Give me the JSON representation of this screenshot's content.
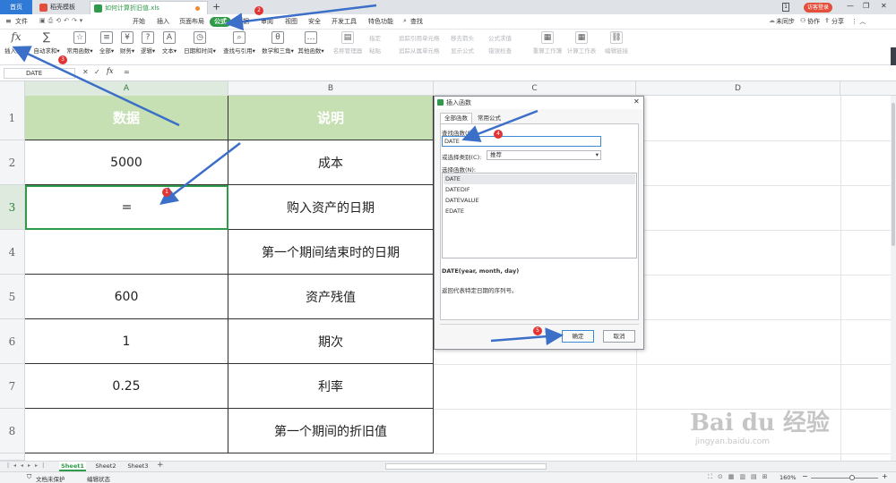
{
  "tabs": {
    "home": "首页",
    "template": "稻壳模板",
    "file": "如何计算折旧值.xls",
    "add": "+"
  },
  "titlebar": {
    "window_controls": [
      "1",
      "—",
      "❐",
      "✕"
    ],
    "login": "访客登录"
  },
  "menubar": {
    "file": "文件",
    "items": [
      "开始",
      "插入",
      "页面布局",
      "公式",
      "数据",
      "审阅",
      "视图",
      "安全",
      "开发工具",
      "特色功能"
    ],
    "active": "公式",
    "search": "查找",
    "sync": "未同步",
    "collab": "协作",
    "share": "分享"
  },
  "ribbon": {
    "buttons": [
      "插入函数",
      "自动求和",
      "常用函数",
      "全部",
      "财务",
      "逻辑",
      "文本",
      "日期和时间",
      "查找与引用",
      "数学和三角",
      "其他函数"
    ],
    "grey_buttons": [
      "名称管理器",
      "指定",
      "粘贴",
      "追踪引用单元格",
      "追踪从属单元格",
      "移去箭头",
      "显示公式",
      "公式求值",
      "错误检查",
      "重算工作簿",
      "计算工作表",
      "编辑链接"
    ]
  },
  "formulabar": {
    "name_box": "DATE",
    "cancel": "✕",
    "confirm": "✓",
    "fx": "fx",
    "content": "="
  },
  "grid": {
    "columns": [
      "A",
      "B",
      "C",
      "D"
    ],
    "rows": [
      "1",
      "2",
      "3",
      "4",
      "5",
      "6",
      "7",
      "8"
    ],
    "header": [
      "数据",
      "说明"
    ],
    "colA": [
      "5000",
      "=",
      "",
      "600",
      "1",
      "0.25",
      ""
    ],
    "colB": [
      "成本",
      "购入资产的日期",
      "第一个期间结束时的日期",
      "资产残值",
      "期次",
      "利率",
      "第一个期间的折旧值"
    ]
  },
  "dialog": {
    "title": "插入函数",
    "tabs": [
      "全部函数",
      "常用公式"
    ],
    "search_label": "查找函数(S):",
    "search_value": "DATE",
    "category_label": "或选择类别(C):",
    "category_value": "推荐",
    "list_label": "选择函数(N):",
    "functions": [
      "DATE",
      "DATEDIF",
      "DATEVALUE",
      "EDATE"
    ],
    "signature": "DATE(year, month, day)",
    "description": "返回代表特定日期的序列号。",
    "ok": "确定",
    "cancel": "取消"
  },
  "sheets": [
    "Sheet1",
    "Sheet2",
    "Sheet3"
  ],
  "status": {
    "protect": "文档未保护",
    "mode": "编辑状态",
    "zoom": "160%"
  },
  "badges": [
    "1",
    "2",
    "3",
    "4",
    "5"
  ],
  "watermark": {
    "text": "Bai du 经验",
    "sub": "jingyan.baidu.com"
  },
  "colors": {
    "accent": "#2f9a4a",
    "header_fill": "#c6e0b4",
    "annotation": "#3c6fc8",
    "badge": "#e23434"
  }
}
